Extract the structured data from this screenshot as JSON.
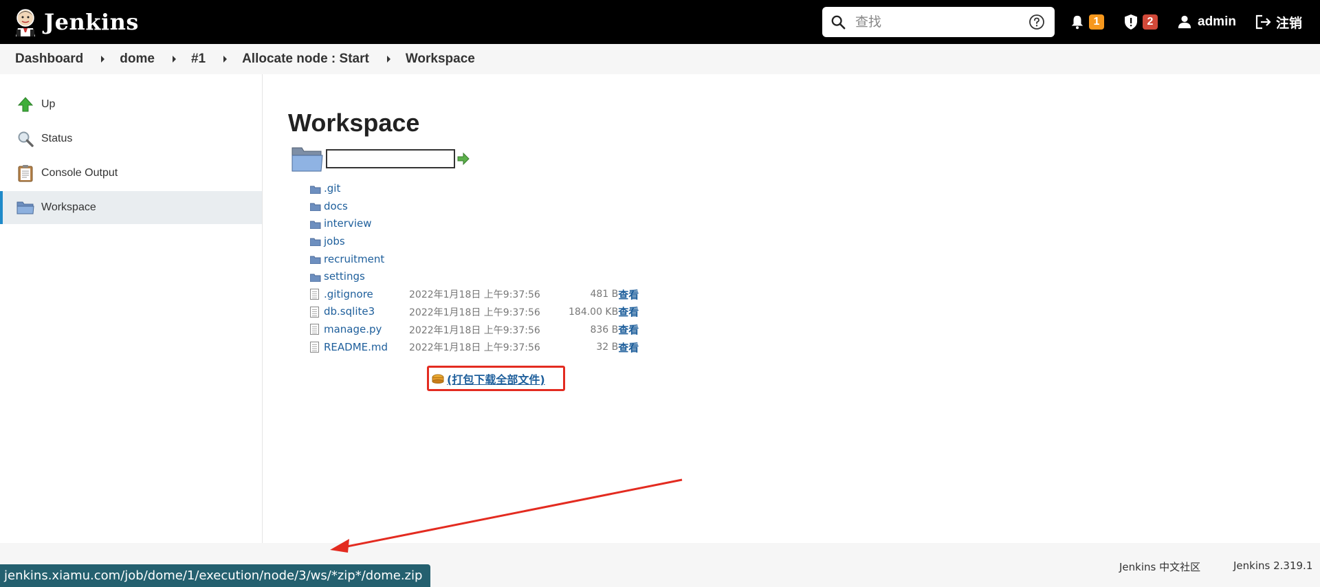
{
  "header": {
    "app_name": "Jenkins",
    "search_placeholder": "查找",
    "notifications_count": "1",
    "security_count": "2",
    "user": "admin",
    "logout": "注销",
    "colors": {
      "bg": "#000000",
      "notif_badge": "#f7981d",
      "security_badge": "#d24939"
    }
  },
  "breadcrumb": [
    "Dashboard",
    "dome",
    "#1",
    "Allocate node : Start",
    "Workspace"
  ],
  "sidebar": {
    "items": [
      {
        "label": "Up",
        "icon": "up-arrow-icon"
      },
      {
        "label": "Status",
        "icon": "magnifier-icon"
      },
      {
        "label": "Console Output",
        "icon": "clipboard-icon"
      },
      {
        "label": "Workspace",
        "icon": "folder-icon",
        "active": true
      }
    ]
  },
  "main": {
    "title": "Workspace",
    "path_value": "",
    "folders": [
      ".git",
      "docs",
      "interview",
      "jobs",
      "recruitment",
      "settings"
    ],
    "files": [
      {
        "name": ".gitignore",
        "date": "2022年1月18日 上午9:37:56",
        "size": "481 B",
        "view": "查看"
      },
      {
        "name": "db.sqlite3",
        "date": "2022年1月18日 上午9:37:56",
        "size": "184.00 KB",
        "view": "查看"
      },
      {
        "name": "manage.py",
        "date": "2022年1月18日 上午9:37:56",
        "size": "836 B",
        "view": "查看"
      },
      {
        "name": "README.md",
        "date": "2022年1月18日 上午9:37:56",
        "size": "32 B",
        "view": "查看"
      }
    ],
    "download_all": "(打包下载全部文件)",
    "highlight_color": "#e32b20"
  },
  "footer": {
    "community": "Jenkins 中文社区",
    "version": "Jenkins 2.319.1"
  },
  "status_url": "jenkins.xiamu.com/job/dome/1/execution/node/3/ws/*zip*/dome.zip"
}
